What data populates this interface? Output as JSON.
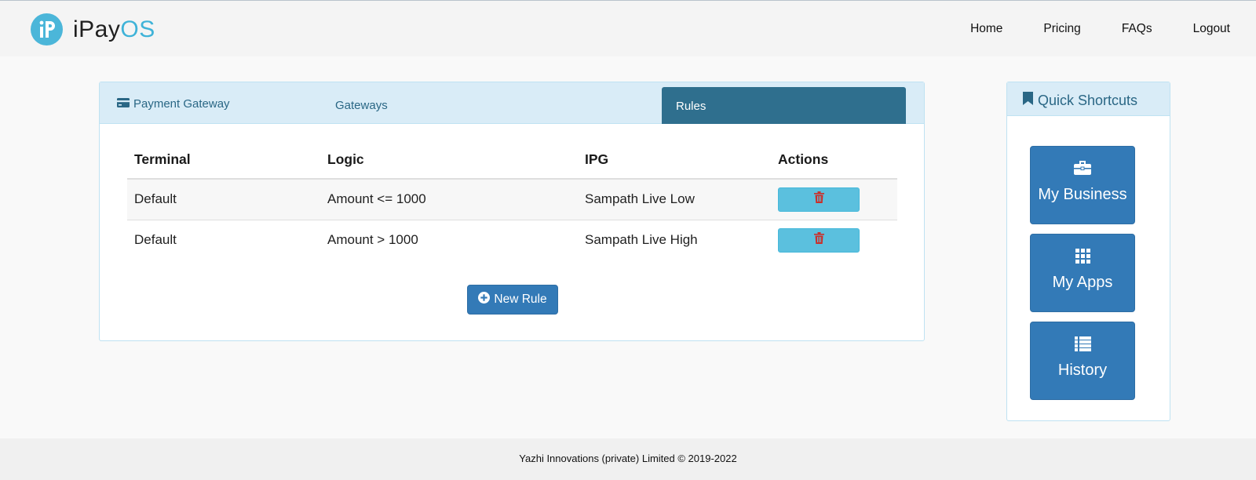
{
  "brand": {
    "part1": "iPay",
    "part2": "OS",
    "colors": {
      "accent": "#3fb3d8",
      "logo": "#4bb6d9"
    }
  },
  "nav": {
    "items": [
      {
        "label": "Home"
      },
      {
        "label": "Pricing"
      },
      {
        "label": "FAQs"
      },
      {
        "label": "Logout"
      }
    ]
  },
  "panel": {
    "title": "Payment Gateway",
    "title_icon": "credit-card-icon",
    "tabs": [
      {
        "label": "Gateways",
        "active": false
      },
      {
        "label": "Rules",
        "active": true
      }
    ],
    "table": {
      "headers": [
        "Terminal",
        "Logic",
        "IPG",
        "Actions"
      ],
      "rows": [
        {
          "terminal": "Default",
          "logic": "Amount <= 1000",
          "ipg": "Sampath Live Low",
          "action_icon": "trash-icon"
        },
        {
          "terminal": "Default",
          "logic": "Amount > 1000",
          "ipg": "Sampath Live High",
          "action_icon": "trash-icon"
        }
      ]
    },
    "new_rule_label": "New Rule",
    "new_rule_icon": "plus-circle-icon"
  },
  "shortcuts": {
    "title": "Quick Shortcuts",
    "title_icon": "bookmark-icon",
    "items": [
      {
        "label": "My Business",
        "icon": "briefcase-icon"
      },
      {
        "label": "My Apps",
        "icon": "grid-icon"
      },
      {
        "label": "History",
        "icon": "list-icon"
      }
    ]
  },
  "footer": {
    "text": "Yazhi Innovations (private) Limited © 2019-2022"
  },
  "colors": {
    "primary": "#337ab7",
    "info": "#5bc0de",
    "tab_active": "#2f6f8e",
    "panel_head": "#d9ecf7",
    "danger_icon": "#c9302c"
  }
}
